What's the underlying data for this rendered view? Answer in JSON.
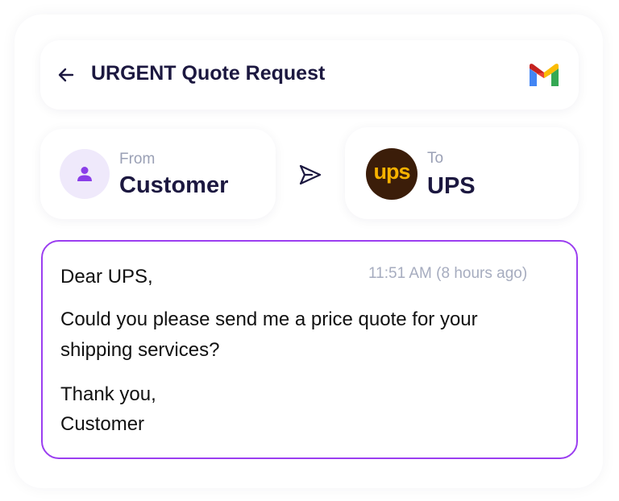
{
  "email": {
    "subject": "URGENT Quote Request",
    "from_caption": "From",
    "from_name": "Customer",
    "to_caption": "To",
    "to_name": "UPS",
    "to_logo_text": "ups",
    "time": "11:51 AM",
    "relative_time": "(8 hours ago)",
    "body": {
      "greeting": "Dear UPS,",
      "line1": "Could you please send me a price quote for your",
      "line2": "shipping services?",
      "closing": "Thank you,",
      "signature": "Customer"
    }
  },
  "icons": {
    "back": "arrow-left-icon",
    "app": "gmail-icon",
    "sender": "person-icon",
    "send": "send-icon"
  },
  "colors": {
    "accent_border": "#9b3ef0",
    "title_text": "#1c1840",
    "avatar_bg": "#efe9fb",
    "avatar_icon": "#8a3ee8",
    "ups_brown": "#3b1d09",
    "ups_gold": "#f7b200",
    "muted_text": "#9aa0b5"
  }
}
